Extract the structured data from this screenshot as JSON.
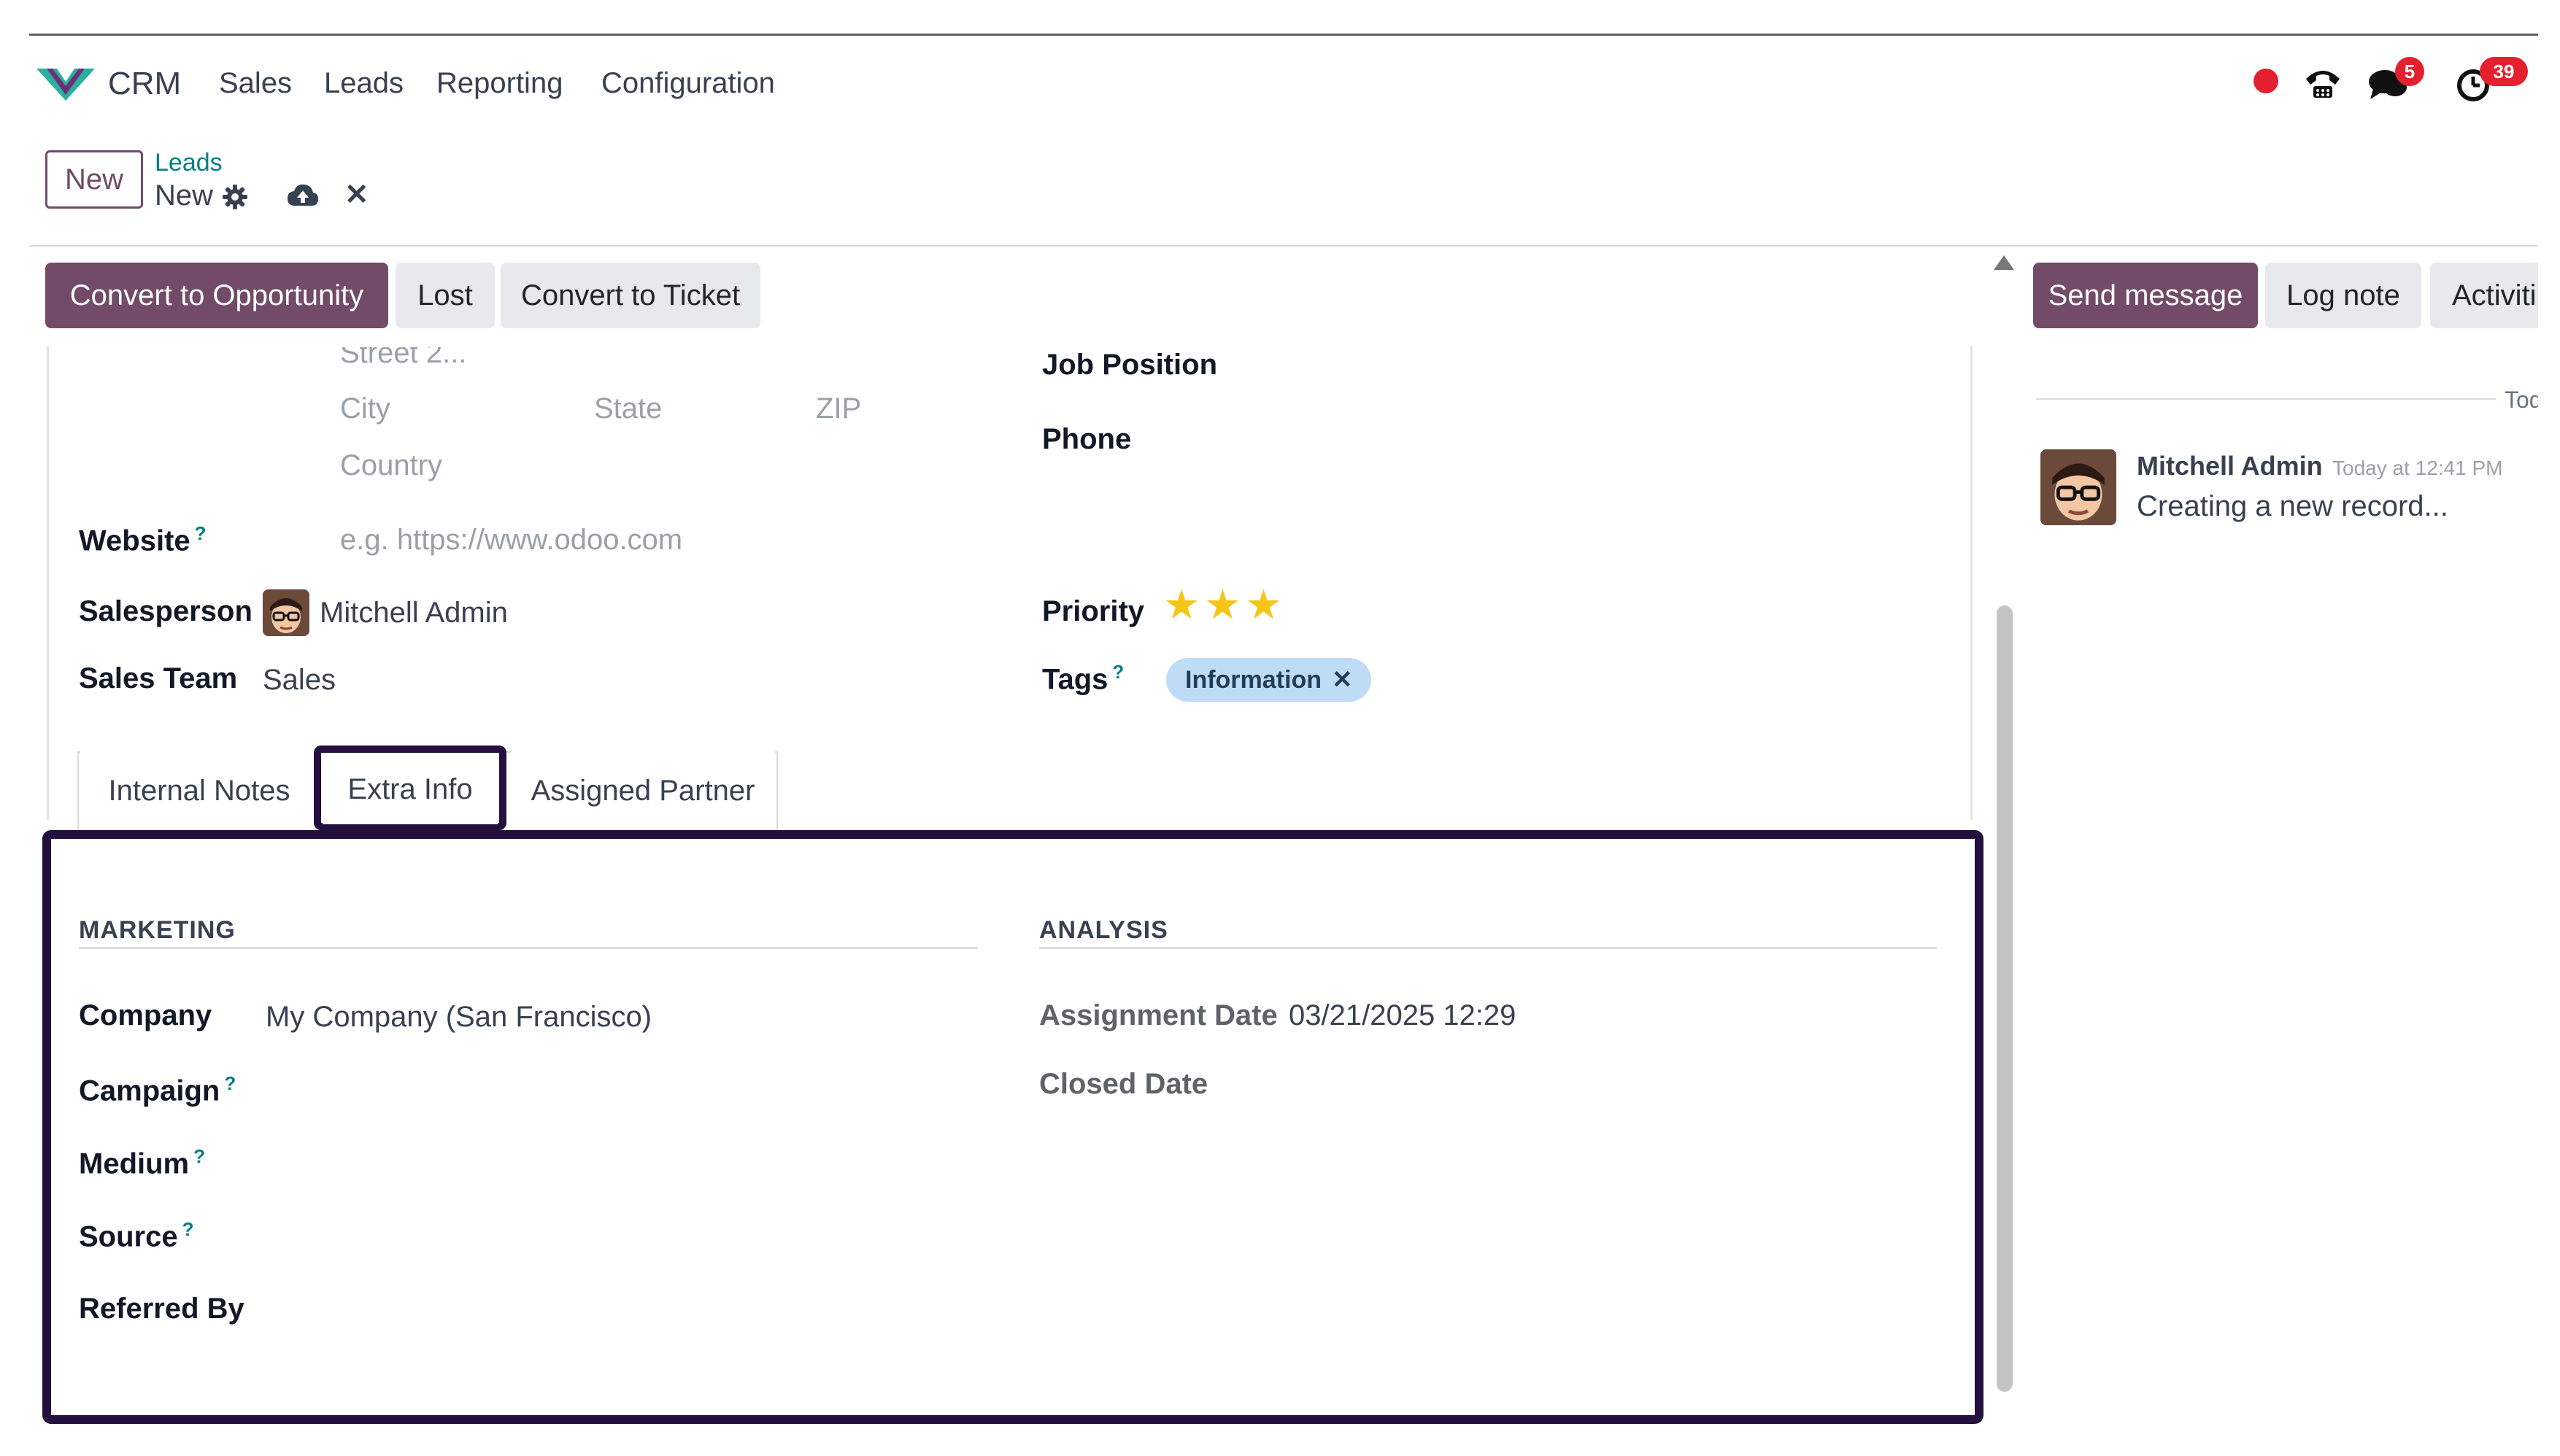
{
  "app": {
    "name": "CRM"
  },
  "menu": [
    "Sales",
    "Leads",
    "Reporting",
    "Configuration"
  ],
  "systray": {
    "messages_count": "5",
    "activities_count": "39"
  },
  "control": {
    "new_button": "New",
    "breadcrumb_parent": "Leads",
    "breadcrumb_current": "New"
  },
  "status_buttons": {
    "convert_opportunity": "Convert to Opportunity",
    "lost": "Lost",
    "convert_ticket": "Convert to Ticket"
  },
  "address": {
    "street2": "Street 2...",
    "city": "City",
    "state": "State",
    "zip": "ZIP",
    "country": "Country"
  },
  "fields": {
    "website_label": "Website",
    "website_placeholder": "e.g. https://www.odoo.com",
    "salesperson_label": "Salesperson",
    "salesperson_value": "Mitchell Admin",
    "sales_team_label": "Sales Team",
    "sales_team_value": "Sales",
    "job_position_label": "Job Position",
    "phone_label": "Phone",
    "priority_label": "Priority",
    "priority_stars": 3,
    "tags_label": "Tags",
    "tag_value": "Information",
    "help_mark": "?"
  },
  "tabs": [
    {
      "label": "Internal Notes"
    },
    {
      "label": "Extra Info"
    },
    {
      "label": "Assigned Partner"
    }
  ],
  "marketing": {
    "title": "MARKETING",
    "company_label": "Company",
    "company_value": "My Company (San Francisco)",
    "campaign_label": "Campaign",
    "medium_label": "Medium",
    "source_label": "Source",
    "referred_label": "Referred By"
  },
  "analysis": {
    "title": "ANALYSIS",
    "assignment_date_label": "Assignment Date",
    "assignment_date_value": "03/21/2025 12:29",
    "closed_date_label": "Closed Date"
  },
  "chatter": {
    "send_message": "Send message",
    "log_note": "Log note",
    "activities": "Activiti",
    "date_divider": "Tod",
    "author": "Mitchell Admin",
    "time": "Today at 12:41 PM",
    "message": "Creating a new record..."
  }
}
